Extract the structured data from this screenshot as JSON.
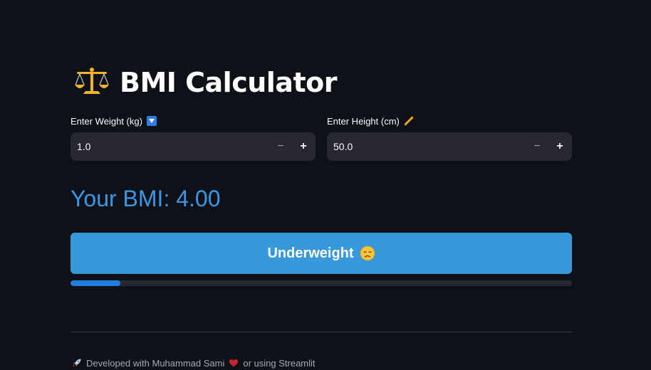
{
  "title": {
    "icon": "balance-scale-icon",
    "text": "BMI Calculator"
  },
  "weight": {
    "label": "Enter Weight (kg)",
    "label_icon": "down-arrow-badge-icon",
    "value": "1.0",
    "decrement_label": "−",
    "increment_label": "+"
  },
  "height": {
    "label": "Enter Height (cm)",
    "label_icon": "ruler-icon",
    "value": "50.0",
    "decrement_label": "−",
    "increment_label": "+"
  },
  "result": {
    "text": "Your BMI: 4.00"
  },
  "category": {
    "text": "Underweight",
    "icon": "sad-face-icon",
    "color": "#3898dc"
  },
  "progress": {
    "fraction": 0.1
  },
  "footer": {
    "rocket_icon": "rocket-icon",
    "text_before": "Developed with Muhammad Sami",
    "heart_icon": "heart-icon",
    "text_after": "or using Streamlit"
  },
  "colors": {
    "background": "#0e1117",
    "accent": "#3a98e6",
    "input_bg": "#262730"
  }
}
